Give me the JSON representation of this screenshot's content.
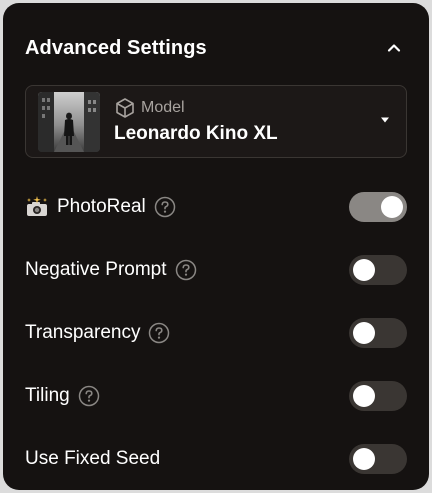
{
  "panel": {
    "title": "Advanced Settings"
  },
  "model": {
    "label": "Model",
    "name": "Leonardo Kino XL"
  },
  "settings": [
    {
      "label": "PhotoReal",
      "has_help": true,
      "enabled": true
    },
    {
      "label": "Negative Prompt",
      "has_help": true,
      "enabled": false
    },
    {
      "label": "Transparency",
      "has_help": true,
      "enabled": false
    },
    {
      "label": "Tiling",
      "has_help": true,
      "enabled": false
    },
    {
      "label": "Use Fixed Seed",
      "has_help": false,
      "enabled": false
    }
  ],
  "colors": {
    "panel_bg": "#151211",
    "toggle_off": "#3a3633",
    "toggle_on": "#8a8784",
    "text": "#ffffff",
    "muted_text": "#a8a39f"
  },
  "icons": [
    "chevron-up-icon",
    "cube-icon",
    "caret-down-icon",
    "camera-sparkle-icon",
    "help-icon"
  ]
}
